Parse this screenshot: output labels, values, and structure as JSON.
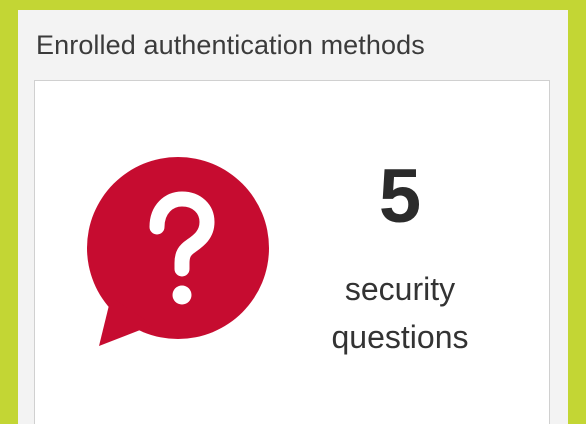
{
  "widget": {
    "title": "Enrolled authentication methods",
    "count": "5",
    "count_label_line1": "security",
    "count_label_line2": "questions",
    "icon": "question-speech-bubble-icon"
  },
  "colors": {
    "background": "#c3d634",
    "panel": "#f3f3f3",
    "tile": "#ffffff",
    "icon_accent": "#c60c30"
  }
}
